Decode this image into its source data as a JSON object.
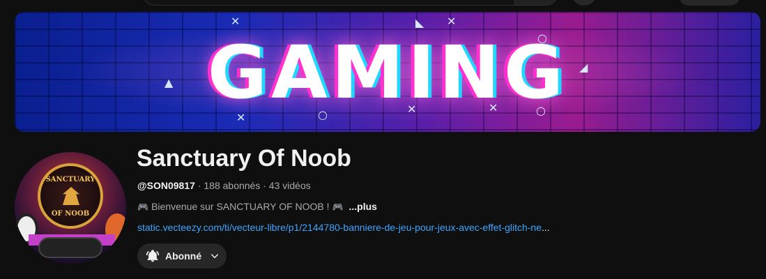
{
  "banner": {
    "headline": "GAMING"
  },
  "channel": {
    "name": "Sanctuary Of Noob",
    "handle": "@SON09817",
    "separator": "·",
    "subscribers": "188 abonnés",
    "videos": "43 vidéos",
    "description_prefix": "Bienvenue sur SANCTUARY OF NOOB !",
    "description_emoji": "🎮",
    "more_label": "...plus",
    "link": "static.vecteezy.com/ti/vecteur-libre/p1/2144780-banniere-de-jeu-pour-jeux-avec-effet-glitch-ne",
    "link_tail": "...",
    "avatar_text_top": "SANCTUARY",
    "avatar_text_bottom": "OF NOOB"
  },
  "subscribe": {
    "label": "Abonné",
    "icon": "bell-icon",
    "dropdown_icon": "chevron-down-icon"
  },
  "colors": {
    "background": "#0f0f0f",
    "link": "#3ea6ff",
    "muted_text": "#aaaaaa",
    "button_bg": "#272727"
  }
}
